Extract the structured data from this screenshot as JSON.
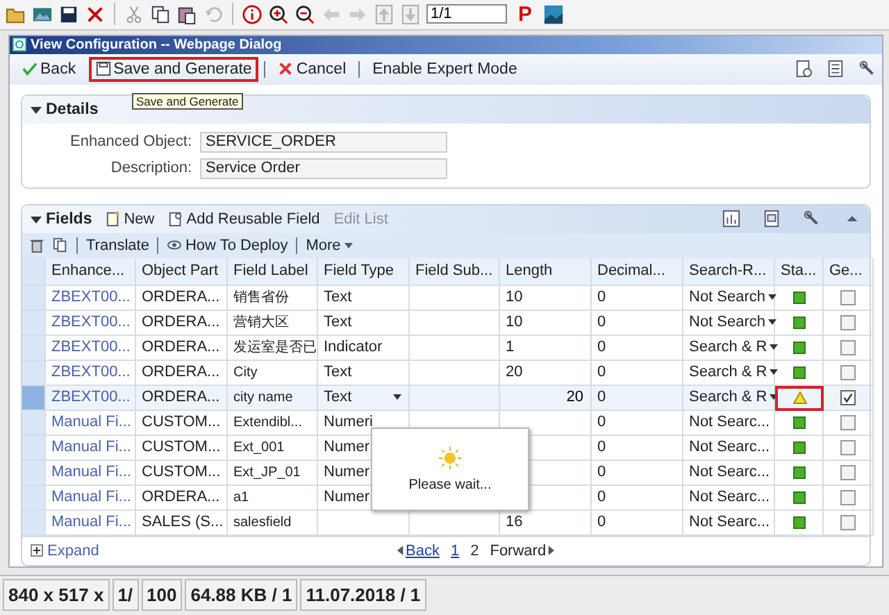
{
  "toolbar": {
    "page_field": "1/1",
    "p_label": "P"
  },
  "window": {
    "title": "View Configuration -- Webpage Dialog"
  },
  "actions": [
    {
      "label": "Back",
      "kind": "back",
      "highlighted": false
    },
    {
      "label": "Save and Generate",
      "kind": "save",
      "highlighted": true
    },
    {
      "label": "Cancel",
      "kind": "cancel",
      "highlighted": false
    },
    {
      "label": "Enable Expert Mode",
      "kind": "plain",
      "highlighted": false
    }
  ],
  "tooltip": "Save and Generate",
  "details": {
    "title": "Details",
    "expanded": true,
    "fields": [
      {
        "label": "Enhanced Object:",
        "value": "SERVICE_ORDER"
      },
      {
        "label": "Description:",
        "value": "Service Order"
      }
    ]
  },
  "fields": {
    "title": "Fields",
    "expanded": true,
    "toolbar": [
      {
        "label": "New",
        "kind": "new",
        "disabled": false
      },
      {
        "label": "Add Reusable Field",
        "kind": "reusable",
        "disabled": false
      },
      {
        "label": "Edit List",
        "kind": "plain",
        "disabled": true
      }
    ],
    "subtoolbar": [
      {
        "label": "Translate",
        "kind": "plain"
      },
      {
        "label": "How To Deploy",
        "kind": "eye"
      },
      {
        "label": "More",
        "kind": "menu"
      }
    ],
    "columns": [
      "Enhance...",
      "Object Part",
      "Field Label",
      "Field Type",
      "Field Sub...",
      "Length",
      "Decimal...",
      "Search-R...",
      "Sta...",
      "Ge..."
    ],
    "rows": [
      {
        "enhancement": "ZBEXT00...",
        "object_part": "ORDERA...",
        "field_label": "销售省份",
        "field_type": "Text",
        "length": "10",
        "decimals": "0",
        "search": "Not Search",
        "search_dropdown": true,
        "warning": false,
        "status_highlighted": false,
        "generate": false,
        "selected": false
      },
      {
        "enhancement": "ZBEXT00...",
        "object_part": "ORDERA...",
        "field_label": "营销大区",
        "field_type": "Text",
        "length": "10",
        "decimals": "0",
        "search": "Not Search",
        "search_dropdown": true,
        "warning": false,
        "status_highlighted": false,
        "generate": false,
        "selected": false
      },
      {
        "enhancement": "ZBEXT00...",
        "object_part": "ORDERA...",
        "field_label": "发运室是否已",
        "field_type": "Indicator",
        "length": "1",
        "decimals": "0",
        "search": "Search & R",
        "search_dropdown": true,
        "warning": false,
        "status_highlighted": false,
        "generate": false,
        "selected": false
      },
      {
        "enhancement": "ZBEXT00...",
        "object_part": "ORDERA...",
        "field_label": "City",
        "field_type": "Text",
        "length": "20",
        "decimals": "0",
        "search": "Search & R",
        "search_dropdown": true,
        "warning": false,
        "status_highlighted": false,
        "generate": false,
        "selected": false
      },
      {
        "enhancement": "ZBEXT00...",
        "object_part": "ORDERA...",
        "field_label": "city name",
        "field_type": "Text",
        "length": "20",
        "decimals": "0",
        "search": "Search & R",
        "search_dropdown": true,
        "warning": true,
        "status_highlighted": true,
        "generate": true,
        "selected": true
      },
      {
        "enhancement": "Manual Fi...",
        "object_part": "CUSTOM...",
        "field_label": "Extendibl...",
        "field_type": "Numeri",
        "length": "",
        "decimals": "0",
        "search": "Not Searc...",
        "search_dropdown": false,
        "warning": false,
        "status_highlighted": false,
        "generate": false,
        "selected": false
      },
      {
        "enhancement": "Manual Fi...",
        "object_part": "CUSTOM...",
        "field_label": "Ext_001",
        "field_type": "Numer",
        "length": "",
        "decimals": "0",
        "search": "Not Searc...",
        "search_dropdown": false,
        "warning": false,
        "status_highlighted": false,
        "generate": false,
        "selected": false
      },
      {
        "enhancement": "Manual Fi...",
        "object_part": "CUSTOM...",
        "field_label": "Ext_JP_01",
        "field_type": "Numer",
        "length": "",
        "decimals": "0",
        "search": "Not Searc...",
        "search_dropdown": false,
        "warning": false,
        "status_highlighted": false,
        "generate": false,
        "selected": false
      },
      {
        "enhancement": "Manual Fi...",
        "object_part": "ORDERA...",
        "field_label": "a1",
        "field_type": "Numer",
        "length": "",
        "decimals": "0",
        "search": "Not Searc...",
        "search_dropdown": false,
        "warning": false,
        "status_highlighted": false,
        "generate": false,
        "selected": false
      },
      {
        "enhancement": "Manual Fi...",
        "object_part": "SALES (S...",
        "field_label": "salesfield",
        "field_type": "",
        "length": "16",
        "decimals": "0",
        "search": "Not Searc...",
        "search_dropdown": false,
        "warning": false,
        "status_highlighted": false,
        "generate": false,
        "selected": false
      }
    ],
    "expand": "Expand",
    "pager": {
      "back": "Back",
      "pages": [
        {
          "label": "1",
          "selected": false
        },
        {
          "label": "2",
          "selected": true
        }
      ],
      "forward": "Forward"
    },
    "wait": "Please wait..."
  },
  "status_bar": [
    "840 x 517 x",
    "1/",
    "100",
    "64.88 KB / 1",
    "11.07.2018 / 1"
  ]
}
